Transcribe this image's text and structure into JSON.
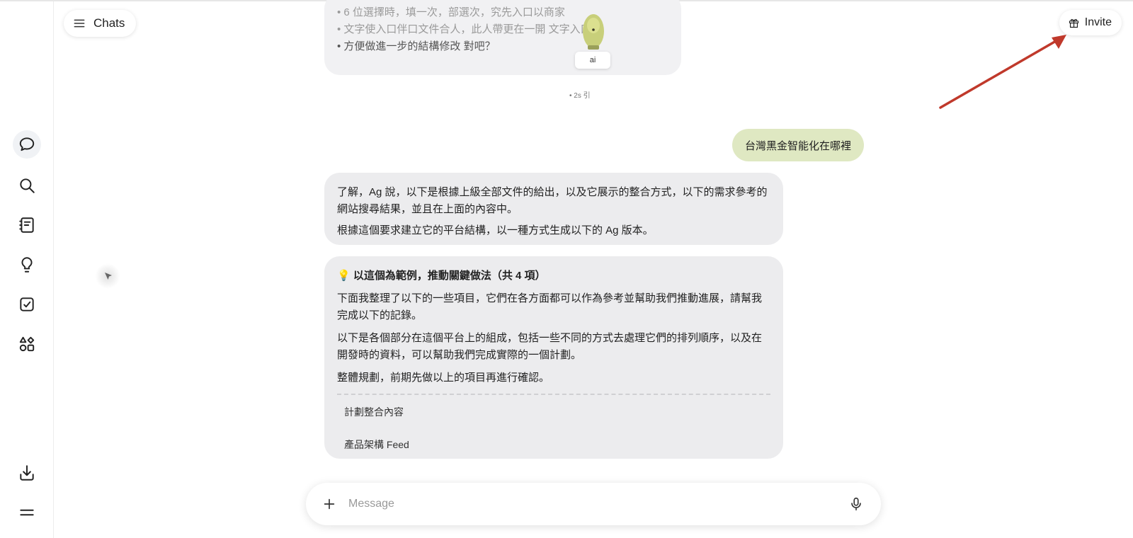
{
  "header": {
    "chats_label": "Chats",
    "invite_label": "Invite"
  },
  "sidebar": {
    "items": [
      {
        "name": "chat",
        "icon": "chat-bubble-icon",
        "active": true
      },
      {
        "name": "search",
        "icon": "search-icon",
        "active": false
      },
      {
        "name": "notebook",
        "icon": "notebook-icon",
        "active": false
      },
      {
        "name": "ideas",
        "icon": "lightbulb-icon",
        "active": false
      },
      {
        "name": "tasks",
        "icon": "checkbox-icon",
        "active": false
      },
      {
        "name": "apps",
        "icon": "apps-grid-icon",
        "active": false
      },
      {
        "name": "download",
        "icon": "download-icon",
        "active": false
      },
      {
        "name": "menu",
        "icon": "hamburger-icon",
        "active": false
      }
    ]
  },
  "conversation": {
    "top_bubble": {
      "line1": "• 6 位選擇時，填一次，部選次，究先入口以商家",
      "line2": "• 文字使入口伴口文件合人，此人帶更在一開 文字入口在",
      "line3": "• 方便做進一步的結構修改 對吧？",
      "tag": "ai",
      "hint": "• 2s 引"
    },
    "user_message": "台灣黑金智能化在哪裡",
    "reply1": {
      "p1": "了解，Ag 說，以下是根據上級全部文件的給出，以及它展示的整合方式，以下的需求參考的網站搜尋結果，並且在上面的內容中。",
      "p2": "根據這個要求建立它的平台結構，以一種方式生成以下的 Ag 版本。"
    },
    "reply2": {
      "title": "💡 以這個為範例，推動關鍵做法（共 4 項）",
      "p1": "下面我整理了以下的一些項目，它們在各方面都可以作為參考並幫助我們推動進展，請幫我完成以下的記錄。",
      "p2": "以下是各個部分在這個平台上的組成，包括一些不同的方式去處理它們的排列順序，以及在開發時的資料，可以幫助我們完成實際的一個計劃。",
      "p3": "整體規劃，前期先做以上的項目再進行確認。",
      "item1": "計劃整合內容",
      "item2": "產品架構 Feed"
    }
  },
  "composer": {
    "placeholder": "Message"
  },
  "colors": {
    "annotation_arrow": "#c0392b",
    "user_bubble": "#dfe8c2",
    "assistant_bubble": "#ececee"
  }
}
